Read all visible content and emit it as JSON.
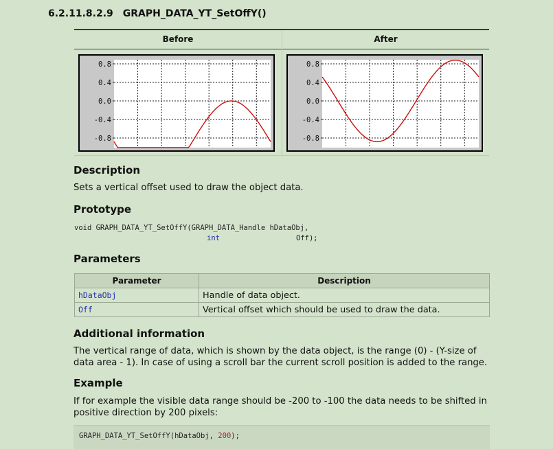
{
  "heading": {
    "number": "6.2.11.8.2.9",
    "title": "GRAPH_DATA_YT_SetOffY()"
  },
  "figure": {
    "before_label": "Before",
    "after_label": "After",
    "y_ticks": [
      "0.8",
      "0.4",
      "0.0",
      "-0.4",
      "-0.8"
    ],
    "curve_color": "#cc1111"
  },
  "description": {
    "title": "Description",
    "text": "Sets a vertical offset used to draw the object data."
  },
  "prototype": {
    "title": "Prototype",
    "line1": "void GRAPH_DATA_YT_SetOffY(GRAPH_DATA_Handle hDataObj,",
    "line2_type": "int",
    "line2_name": "Off);"
  },
  "parameters": {
    "title": "Parameters",
    "header_param": "Parameter",
    "header_desc": "Description",
    "rows": [
      {
        "name": "hDataObj",
        "desc": "Handle of data object."
      },
      {
        "name": "Off",
        "desc": "Vertical offset which should be used to draw the data."
      }
    ]
  },
  "additional": {
    "title": "Additional information",
    "text": "The vertical range of data, which is shown by the data object, is the range (0) - (Y-size of data area - 1). In case of using a scroll bar the current scroll position is added to the range."
  },
  "example": {
    "title": "Example",
    "text": "If for example the visible data range should be -200 to -100 the data needs to be shifted in positive direction by 200 pixels:",
    "code_prefix": "GRAPH_DATA_YT_SetOffY(hDataObj, ",
    "code_value": "200",
    "code_suffix": ");"
  }
}
